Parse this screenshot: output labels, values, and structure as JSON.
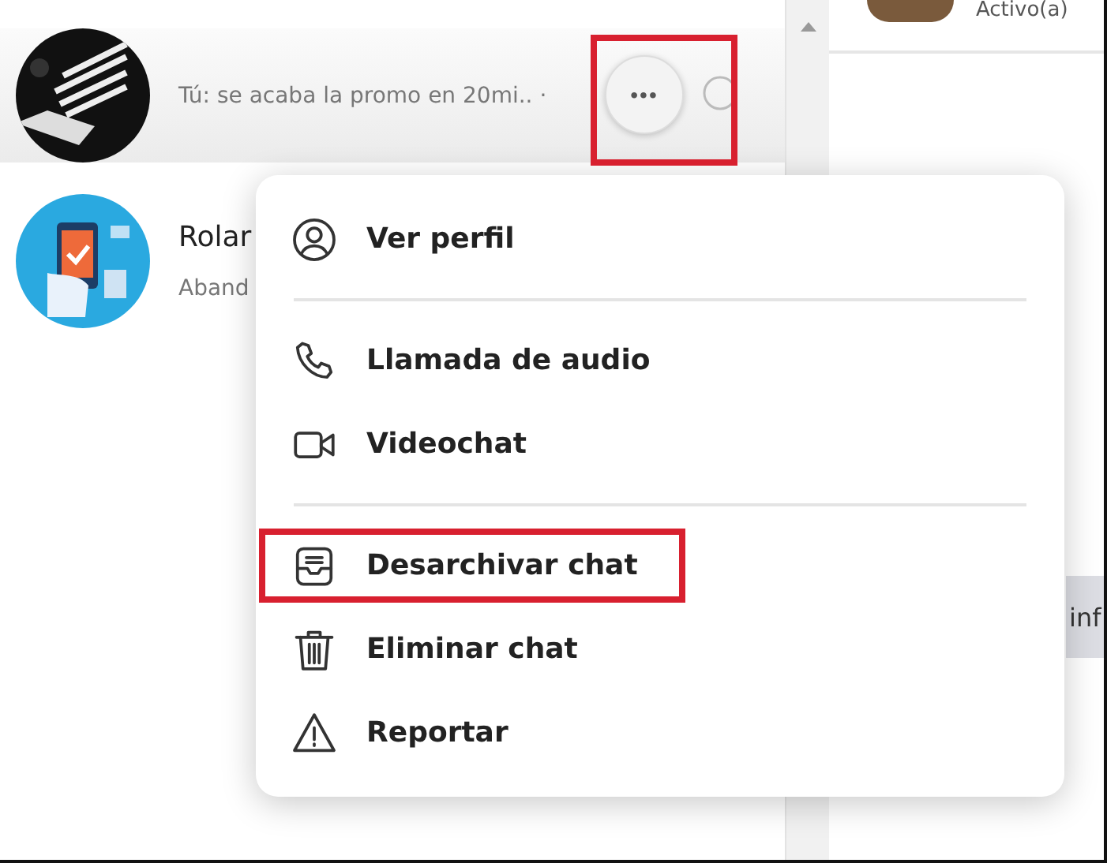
{
  "chat_list": [
    {
      "preview": "Tú: se acaba la promo en 20mi.. ·",
      "hovered": true
    },
    {
      "name": "Rolar",
      "preview": "Aband",
      "hovered": false
    }
  ],
  "more_button": {
    "label": "•••",
    "annotated": true
  },
  "header": {
    "status": "Activo(a)"
  },
  "info_chip": {
    "label": "inf"
  },
  "menu": {
    "groups": [
      [
        {
          "label": "Ver perfil",
          "annotated": false
        }
      ],
      [
        {
          "label": "Llamada de audio",
          "annotated": false
        },
        {
          "label": "Videochat",
          "annotated": false
        }
      ],
      [
        {
          "label": "Desarchivar chat",
          "annotated": true
        },
        {
          "label": "Eliminar chat",
          "annotated": false
        },
        {
          "label": "Reportar",
          "annotated": false
        }
      ]
    ]
  }
}
